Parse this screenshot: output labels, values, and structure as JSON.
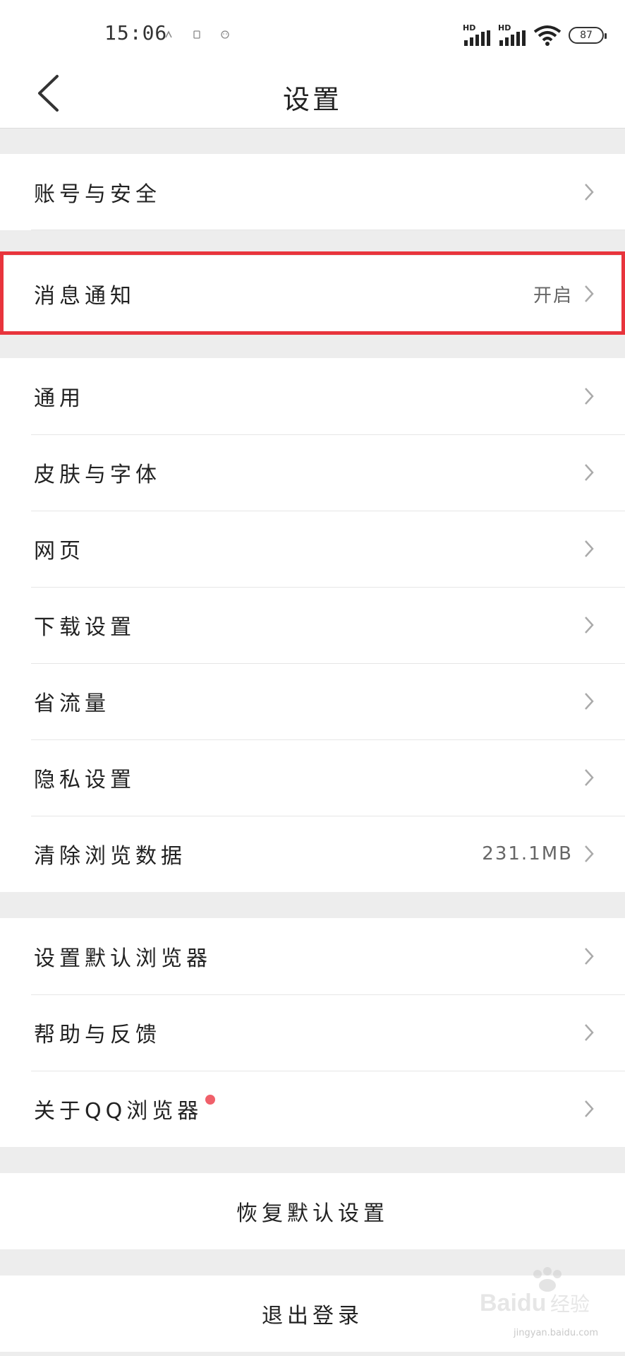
{
  "status_bar": {
    "time": "15:06",
    "hd_label_1": "HD",
    "hd_label_2": "HD",
    "battery": "87"
  },
  "header": {
    "title": "设置"
  },
  "groups": [
    {
      "items": [
        {
          "label": "账号与安全",
          "value": ""
        }
      ]
    },
    {
      "items": [
        {
          "label": "消息通知",
          "value": "开启"
        }
      ]
    },
    {
      "items": [
        {
          "label": "通用",
          "value": ""
        },
        {
          "label": "皮肤与字体",
          "value": ""
        },
        {
          "label": "网页",
          "value": ""
        },
        {
          "label": "下载设置",
          "value": ""
        },
        {
          "label": "省流量",
          "value": ""
        },
        {
          "label": "隐私设置",
          "value": ""
        },
        {
          "label": "清除浏览数据",
          "value": "231.1MB"
        }
      ]
    },
    {
      "items": [
        {
          "label": "设置默认浏览器",
          "value": ""
        },
        {
          "label": "帮助与反馈",
          "value": ""
        },
        {
          "label": "关于QQ浏览器",
          "value": ""
        }
      ]
    }
  ],
  "actions": {
    "restore_defaults": "恢复默认设置",
    "logout": "退出登录"
  },
  "watermark": {
    "brand": "Baidu",
    "cn": "经验",
    "url": "jingyan.baidu.com"
  },
  "colors": {
    "highlight": "#e8343c",
    "badge": "#f0606a"
  }
}
